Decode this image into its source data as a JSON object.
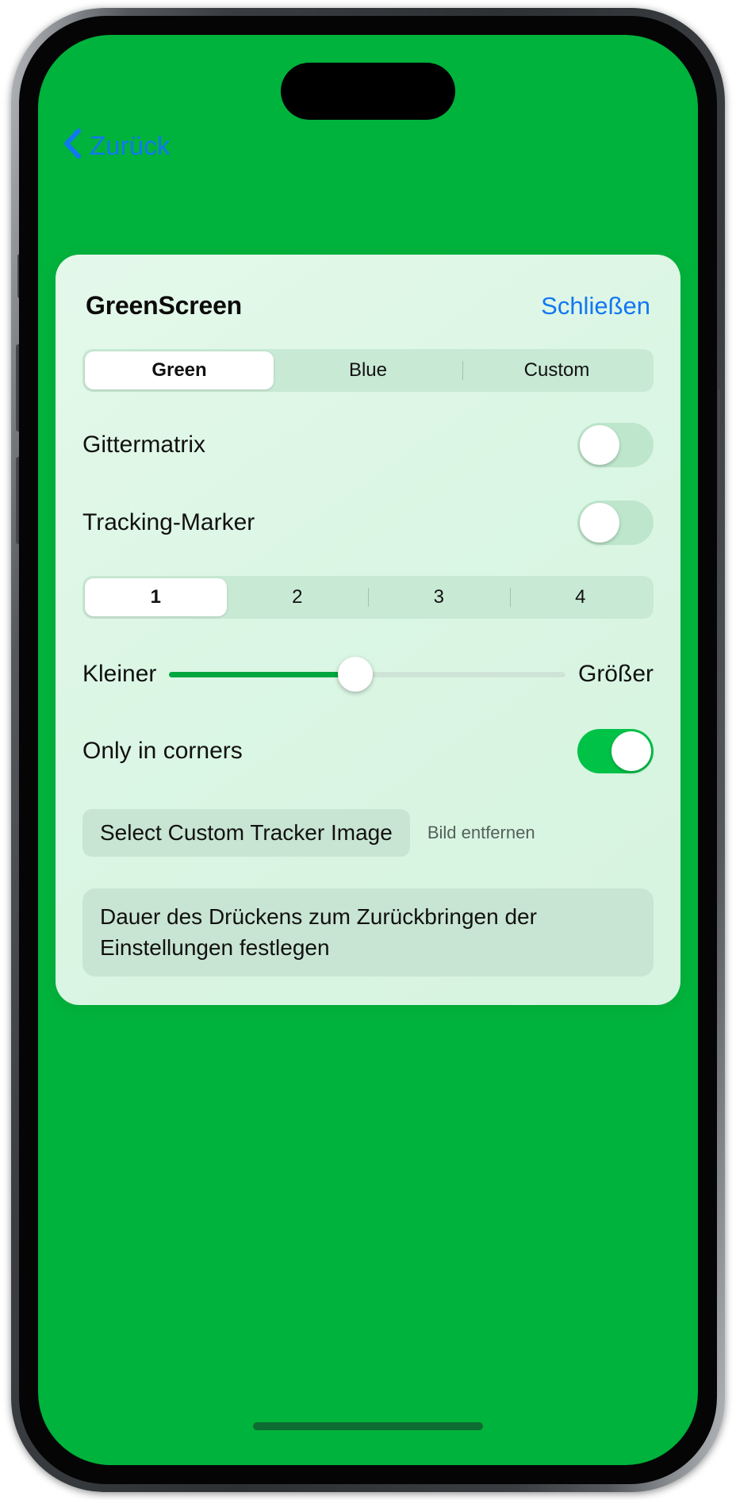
{
  "nav": {
    "back_label": "Zurück",
    "back_icon": "chevron-left-icon"
  },
  "card": {
    "title": "GreenScreen",
    "close_label": "Schließen"
  },
  "color_segmented": {
    "selected_index": 0,
    "options": [
      "Green",
      "Blue",
      "Custom"
    ]
  },
  "grid_matrix": {
    "label": "Gittermatrix",
    "state": "off"
  },
  "tracking_marker": {
    "label": "Tracking-Marker",
    "state": "off"
  },
  "count_segmented": {
    "selected_index": 0,
    "options": [
      "1",
      "2",
      "3",
      "4"
    ]
  },
  "size_slider": {
    "min_label": "Kleiner",
    "max_label": "Größer",
    "value_percent": 47
  },
  "only_corners": {
    "label": "Only in corners",
    "state": "on"
  },
  "tracker_image": {
    "select_label": "Select Custom Tracker Image",
    "remove_label": "Bild entfernen"
  },
  "duration_setting": {
    "text": "Dauer des Drückens zum Zurückbringen der Einstellungen festlegen"
  },
  "colors": {
    "screen_background": "#00B33C",
    "card_background": "#DEF6E6",
    "accent_blue": "#1277F2",
    "toggle_on": "#00C247",
    "toggle_off": "#BDE6CC",
    "slider_fill": "#00A63E"
  }
}
